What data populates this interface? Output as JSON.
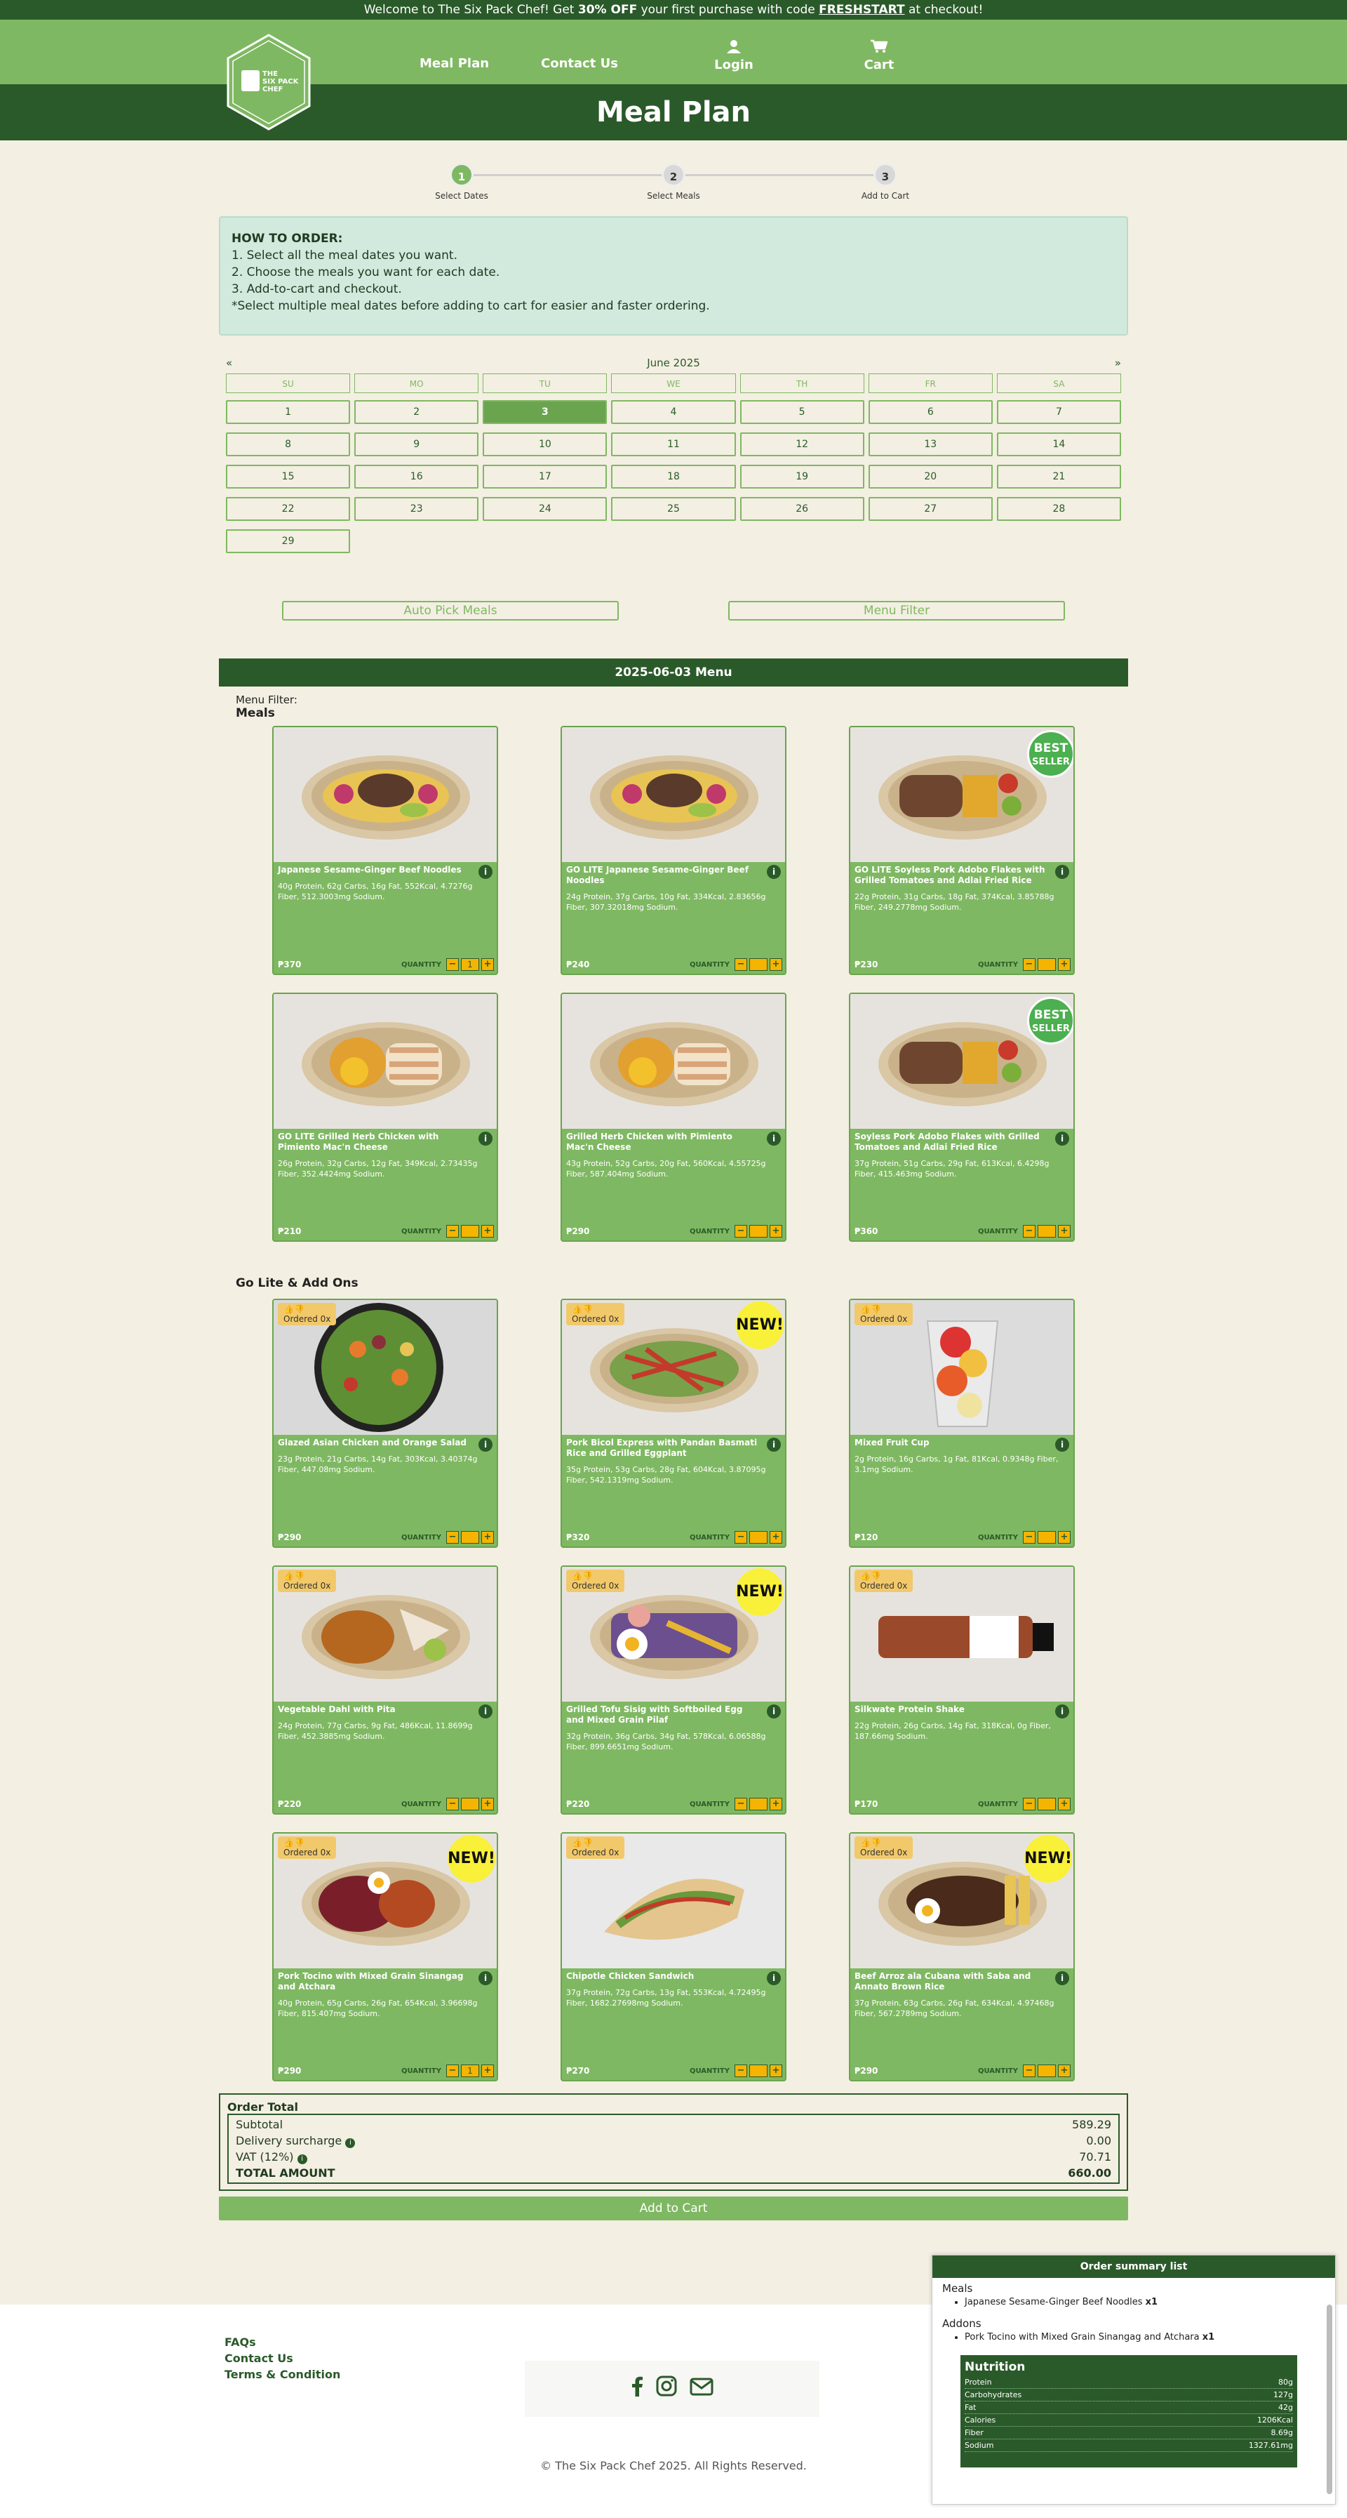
{
  "promo": {
    "pre": "Welcome to The Six Pack Chef! Get ",
    "discount": "30% OFF",
    "mid": " your first purchase with code ",
    "code": "FRESHSTART",
    "post": " at checkout!"
  },
  "nav": {
    "meal_plan": "Meal Plan",
    "contact": "Contact Us",
    "login": "Login",
    "cart": "Cart",
    "logo_text": "THE SIX PACK CHEF"
  },
  "page_title": "Meal Plan",
  "steps": [
    {
      "num": "1",
      "label": "Select Dates"
    },
    {
      "num": "2",
      "label": "Select Meals"
    },
    {
      "num": "3",
      "label": "Add to Cart"
    }
  ],
  "howto": {
    "title": "HOW TO ORDER:",
    "lines": [
      "1. Select all the meal dates you want.",
      "2. Choose the meals you want for each date.",
      "3. Add-to-cart and checkout.",
      "*Select multiple meal dates before adding to cart for easier and faster ordering."
    ]
  },
  "calendar": {
    "month": "June 2025",
    "prev": "«",
    "next": "»",
    "dows": [
      "SU",
      "MO",
      "TU",
      "WE",
      "TH",
      "FR",
      "SA"
    ],
    "days": [
      "1",
      "2",
      "3",
      "4",
      "5",
      "6",
      "7",
      "8",
      "9",
      "10",
      "11",
      "12",
      "13",
      "14",
      "15",
      "16",
      "17",
      "18",
      "19",
      "20",
      "21",
      "22",
      "23",
      "24",
      "25",
      "26",
      "27",
      "28",
      "29"
    ],
    "selected": "3"
  },
  "buttons": {
    "auto_pick": "Auto Pick Meals",
    "menu_filter": "Menu Filter",
    "add_to_cart": "Add to Cart"
  },
  "menu": {
    "title": "2025-06-03 Menu",
    "filter_label": "Menu Filter:",
    "meals_heading": "Meals",
    "golite_heading": "Go Lite & Add Ons",
    "qty_label": "QUANTITY"
  },
  "meals": [
    {
      "name": "Japanese Sesame-Ginger Beef Noodles",
      "desc": "40g Protein, 62g Carbs, 16g Fat, 552Kcal, 4.7276g Fiber, 512.3003mg Sodium.",
      "price": "₱370",
      "qty": "1",
      "badge": ""
    },
    {
      "name": "GO LITE Japanese Sesame-Ginger Beef Noodles",
      "desc": "24g Protein, 37g Carbs, 10g Fat, 334Kcal, 2.83656g Fiber, 307.32018mg Sodium.",
      "price": "₱240",
      "qty": "",
      "badge": ""
    },
    {
      "name": "GO LITE Soyless Pork Adobo Flakes with Grilled Tomatoes and Adlai Fried Rice",
      "desc": "22g Protein, 31g Carbs, 18g Fat, 374Kcal, 3.85788g Fiber, 249.2778mg Sodium.",
      "price": "₱230",
      "qty": "",
      "badge": "BEST SELLER"
    },
    {
      "name": "GO LITE Grilled Herb Chicken with Pimiento Mac'n Cheese",
      "desc": "26g Protein, 32g Carbs, 12g Fat, 349Kcal, 2.73435g Fiber, 352.4424mg Sodium.",
      "price": "₱210",
      "qty": "",
      "badge": ""
    },
    {
      "name": "Grilled Herb Chicken with Pimiento Mac'n Cheese",
      "desc": "43g Protein, 52g Carbs, 20g Fat, 560Kcal, 4.55725g Fiber, 587.404mg Sodium.",
      "price": "₱290",
      "qty": "",
      "badge": ""
    },
    {
      "name": "Soyless Pork Adobo Flakes with Grilled Tomatoes and Adlai Fried Rice",
      "desc": "37g Protein, 51g Carbs, 29g Fat, 613Kcal, 6.4298g Fiber, 415.463mg Sodium.",
      "price": "₱360",
      "qty": "",
      "badge": "BEST SELLER"
    }
  ],
  "addons": [
    {
      "name": "Glazed Asian Chicken and Orange Salad",
      "desc": "23g Protein, 21g Carbs, 14g Fat, 303Kcal, 3.40374g Fiber, 447.08mg Sodium.",
      "price": "₱290",
      "qty": "",
      "ordered": "Ordered 0x",
      "badge": ""
    },
    {
      "name": "Pork Bicol Express with Pandan Basmati Rice and Grilled Eggplant",
      "desc": "35g Protein, 53g Carbs, 28g Fat, 604Kcal, 3.87095g Fiber, 542.1319mg Sodium.",
      "price": "₱320",
      "qty": "",
      "ordered": "Ordered 0x",
      "badge": "NEW!"
    },
    {
      "name": "Mixed Fruit Cup",
      "desc": "2g Protein, 16g Carbs, 1g Fat, 81Kcal, 0.9348g Fiber, 3.1mg Sodium.",
      "price": "₱120",
      "qty": "",
      "ordered": "Ordered 0x",
      "badge": ""
    },
    {
      "name": "Vegetable Dahl with Pita",
      "desc": "24g Protein, 77g Carbs, 9g Fat, 486Kcal, 11.8699g Fiber, 452.3885mg Sodium.",
      "price": "₱220",
      "qty": "",
      "ordered": "Ordered 0x",
      "badge": ""
    },
    {
      "name": "Grilled Tofu Sisig with Softboiled Egg and Mixed Grain Pilaf",
      "desc": "32g Protein, 36g Carbs, 34g Fat, 578Kcal, 6.06588g Fiber, 899.6651mg Sodium.",
      "price": "₱220",
      "qty": "",
      "ordered": "Ordered 0x",
      "badge": "NEW!"
    },
    {
      "name": "Silkwate Protein Shake",
      "desc": "22g Protein, 26g Carbs, 14g Fat, 318Kcal, 0g Fiber, 187.66mg Sodium.",
      "price": "₱170",
      "qty": "",
      "ordered": "Ordered 0x",
      "badge": ""
    },
    {
      "name": "Pork Tocino with Mixed Grain Sinangag and Atchara",
      "desc": "40g Protein, 65g Carbs, 26g Fat, 654Kcal, 3.96698g Fiber, 815.407mg Sodium.",
      "price": "₱290",
      "qty": "1",
      "ordered": "Ordered 0x",
      "badge": "NEW!"
    },
    {
      "name": "Chipotle Chicken Sandwich",
      "desc": "37g Protein, 72g Carbs, 13g Fat, 553Kcal, 4.72495g Fiber, 1682.27698mg Sodium.",
      "price": "₱270",
      "qty": "",
      "ordered": "Ordered 0x",
      "badge": ""
    },
    {
      "name": "Beef Arroz ala Cubana with Saba and Annato Brown Rice",
      "desc": "37g Protein, 63g Carbs, 26g Fat, 634Kcal, 4.97468g Fiber, 567.2789mg Sodium.",
      "price": "₱290",
      "qty": "",
      "ordered": "Ordered 0x",
      "badge": "NEW!"
    }
  ],
  "order_total": {
    "title": "Order Total",
    "rows": [
      {
        "label": "Subtotal",
        "value": "589.29"
      },
      {
        "label": "Delivery surcharge",
        "value": "0.00"
      },
      {
        "label": "VAT (12%)",
        "value": "70.71"
      },
      {
        "label": "TOTAL AMOUNT",
        "value": "660.00"
      }
    ]
  },
  "footer": {
    "links": [
      "FAQs",
      "Contact Us",
      "Terms & Condition"
    ],
    "copyright": "© The Six Pack Chef 2025. All Rights Reserved."
  },
  "summary": {
    "title": "Order summary list",
    "meals_label": "Meals",
    "meals": [
      {
        "name": "Japanese Sesame-Ginger Beef Noodles",
        "qty": "x1"
      }
    ],
    "addons_label": "Addons",
    "addons": [
      {
        "name": "Pork Tocino with Mixed Grain Sinangag and Atchara",
        "qty": "x1"
      }
    ],
    "nutrition_title": "Nutrition",
    "nutrition": [
      {
        "label": "Protein",
        "value": "80g"
      },
      {
        "label": "Carbohydrates",
        "value": "127g"
      },
      {
        "label": "Fat",
        "value": "42g"
      },
      {
        "label": "Calories",
        "value": "1206Kcal"
      },
      {
        "label": "Fiber",
        "value": "8.69g"
      },
      {
        "label": "Sodium",
        "value": "1327.61mg"
      }
    ]
  },
  "colors": {
    "dark_green": "#2b5a2a",
    "green": "#7fb862",
    "cream": "#f3efe2",
    "yellow": "#f5b400"
  }
}
